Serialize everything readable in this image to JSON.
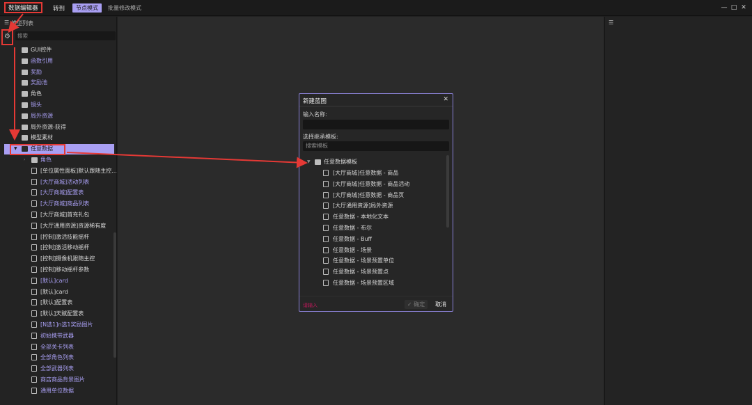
{
  "titlebar": {
    "app_title": "数据编辑器",
    "goto": "转到",
    "mode_node": "节点模式",
    "mode_batch": "批量修改模式",
    "minimize": "—",
    "maximize": "□",
    "close": "✕"
  },
  "left_panel": {
    "header": "模型列表",
    "search_placeholder": "搜索",
    "items": [
      {
        "label": "GUI控件",
        "kind": "folder",
        "level": 0,
        "expanded": false,
        "color": "white"
      },
      {
        "label": "函数引用",
        "kind": "folder",
        "level": 0,
        "expanded": false,
        "color": "purple"
      },
      {
        "label": "奖励",
        "kind": "folder",
        "level": 0,
        "expanded": false,
        "color": "purple"
      },
      {
        "label": "奖励池",
        "kind": "folder",
        "level": 0,
        "expanded": false,
        "color": "purple"
      },
      {
        "label": "角色",
        "kind": "folder",
        "level": 0,
        "expanded": false,
        "color": "white"
      },
      {
        "label": "镜头",
        "kind": "folder",
        "level": 0,
        "expanded": false,
        "color": "purple"
      },
      {
        "label": "局外资源",
        "kind": "folder",
        "level": 0,
        "expanded": false,
        "color": "purple"
      },
      {
        "label": "局外资源-获得",
        "kind": "folder",
        "level": 0,
        "expanded": false,
        "color": "white"
      },
      {
        "label": "模型素材",
        "kind": "folder",
        "level": 0,
        "expanded": false,
        "color": "white"
      },
      {
        "label": "任意数据",
        "kind": "folder",
        "level": 0,
        "expanded": true,
        "color": "selected"
      },
      {
        "label": "角色",
        "kind": "folder",
        "level": 1,
        "expanded": false,
        "color": "purple"
      },
      {
        "label": "[单位属性面板]默认跟随主控...",
        "kind": "file",
        "level": 1,
        "color": "white"
      },
      {
        "label": "[大厅商城]活动列表",
        "kind": "file",
        "level": 1,
        "color": "purple"
      },
      {
        "label": "[大厅商城]配置表",
        "kind": "file",
        "level": 1,
        "color": "purple"
      },
      {
        "label": "[大厅商城]商品列表",
        "kind": "file",
        "level": 1,
        "color": "purple"
      },
      {
        "label": "[大厅商城]首充礼包",
        "kind": "file",
        "level": 1,
        "color": "white"
      },
      {
        "label": "[大厅通用资源]资源稀有度",
        "kind": "file",
        "level": 1,
        "color": "white"
      },
      {
        "label": "[控制]激活技能摇杆",
        "kind": "file",
        "level": 1,
        "color": "white"
      },
      {
        "label": "[控制]激活移动摇杆",
        "kind": "file",
        "level": 1,
        "color": "white"
      },
      {
        "label": "[控制]摄像机跟随主控",
        "kind": "file",
        "level": 1,
        "color": "white"
      },
      {
        "label": "[控制]移动摇杆参数",
        "kind": "file",
        "level": 1,
        "color": "white"
      },
      {
        "label": "[默认]card",
        "kind": "file",
        "level": 1,
        "color": "purple"
      },
      {
        "label": "[默认]card",
        "kind": "file",
        "level": 1,
        "color": "white"
      },
      {
        "label": "[默认]配置表",
        "kind": "file",
        "level": 1,
        "color": "white"
      },
      {
        "label": "[默认]天赋配置表",
        "kind": "file",
        "level": 1,
        "color": "white"
      },
      {
        "label": "[N选1]n选1奖励图片",
        "kind": "file",
        "level": 1,
        "color": "purple"
      },
      {
        "label": "初始携带武器",
        "kind": "file",
        "level": 1,
        "color": "purple"
      },
      {
        "label": "全部关卡列表",
        "kind": "file",
        "level": 1,
        "color": "purple"
      },
      {
        "label": "全部角色列表",
        "kind": "file",
        "level": 1,
        "color": "purple"
      },
      {
        "label": "全部武器列表",
        "kind": "file",
        "level": 1,
        "color": "purple"
      },
      {
        "label": "商店商品背景图片",
        "kind": "file",
        "level": 1,
        "color": "purple"
      },
      {
        "label": "通用单位数据",
        "kind": "file",
        "level": 1,
        "color": "purple"
      }
    ]
  },
  "dialog": {
    "title": "新建蓝图",
    "close": "✕",
    "name_label": "输入名称:",
    "name_value": "",
    "template_label": "选择继承模板:",
    "template_search_placeholder": "搜索模板",
    "group_label": "任意数据模板",
    "templates": [
      "[大厅商城]任意数据 - 商品",
      "[大厅商城]任意数据 - 商品活动",
      "[大厅商城]任意数据 - 商品页",
      "[大厅通用资源]局外资源",
      "任意数据 - 本地化文本",
      "任意数据 - 布尔",
      "任意数据 - Buff",
      "任意数据 - 场景",
      "任意数据 - 场景预置单位",
      "任意数据 - 场景预置点",
      "任意数据 - 场景预置区域"
    ],
    "error_text": "请输入",
    "ok_label": "确定",
    "cancel_label": "取消"
  },
  "colors": {
    "accent": "#a99ff3",
    "annotation_red": "#e53935",
    "dialog_border": "#8c83d9",
    "background": "#2b2b2b",
    "panel": "#232323"
  }
}
